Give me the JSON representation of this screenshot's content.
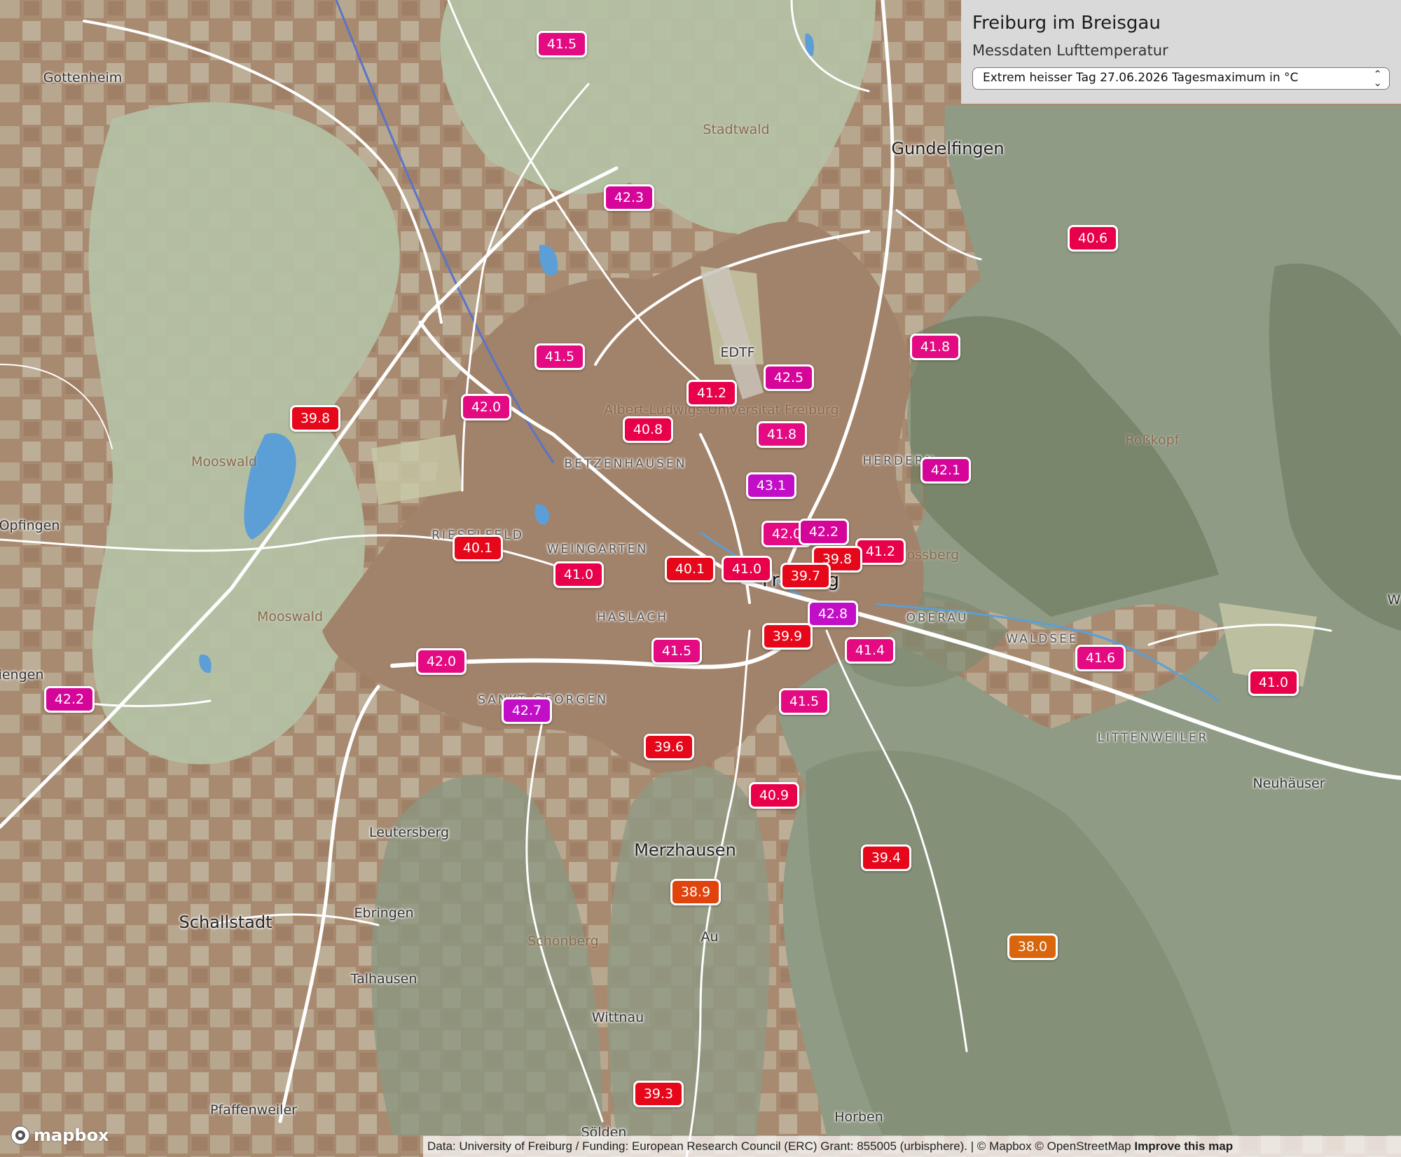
{
  "panel": {
    "title": "Freiburg im Breisgau",
    "subtitle": "Messdaten Lufttemperatur",
    "selected_option": "Extrem heisser Tag 27.06.2026 Tagesmaximum in °C"
  },
  "attribution": {
    "data_text": "Data: University of Freiburg / Funding: European Research Council (ERC) Grant: 855005 (urbisphere).",
    "separator": " | ",
    "mapbox": "© Mapbox",
    "osm": "© OpenStreetMap",
    "improve": "Improve this map"
  },
  "logo_text": "mapbox",
  "legend_colors": {
    "38.0": "#d9650c",
    "38.9": "#e0430d",
    "39.3": "#e6071a",
    "40.6": "#e8004a",
    "41.5": "#e30a82",
    "42.3": "#d6059a",
    "42.7": "#c30ec8"
  },
  "places": [
    {
      "label": "Gottenheim",
      "cls": ""
    },
    {
      "label": "Gundelfingen",
      "cls": "big"
    },
    {
      "label": "Stadtwald",
      "cls": "nature"
    },
    {
      "label": "EDTF",
      "cls": ""
    },
    {
      "label": "Mooswald",
      "cls": "nature"
    },
    {
      "label": "Mooswald",
      "cls": "nature"
    },
    {
      "label": "Opfingen",
      "cls": ""
    },
    {
      "label": "BETZENHAUSEN",
      "cls": "district"
    },
    {
      "label": "RIESELFELD",
      "cls": "district"
    },
    {
      "label": "WEINGARTEN",
      "cls": "district"
    },
    {
      "label": "HASLACH",
      "cls": "district"
    },
    {
      "label": "SANKT GEORGEN",
      "cls": "district"
    },
    {
      "label": "HERDERN",
      "cls": "district"
    },
    {
      "label": "Schlossberg",
      "cls": "nature"
    },
    {
      "label": "OBERAU",
      "cls": "district"
    },
    {
      "label": "WALDSEE",
      "cls": "district"
    },
    {
      "label": "LITTENWEILER",
      "cls": "district"
    },
    {
      "label": "Roßkopf",
      "cls": "nature"
    },
    {
      "label": "Neuhäuser",
      "cls": ""
    },
    {
      "label": "iengen",
      "cls": ""
    },
    {
      "label": "Leutersberg",
      "cls": ""
    },
    {
      "label": "Merzhausen",
      "cls": "big"
    },
    {
      "label": "Schallstadt",
      "cls": "big"
    },
    {
      "label": "Ebringen",
      "cls": ""
    },
    {
      "label": "Schönberg",
      "cls": "nature"
    },
    {
      "label": "Au",
      "cls": ""
    },
    {
      "label": "Talhausen",
      "cls": ""
    },
    {
      "label": "Wittnau",
      "cls": ""
    },
    {
      "label": "Pfaffenweiler",
      "cls": ""
    },
    {
      "label": "Horben",
      "cls": ""
    },
    {
      "label": "Sölden",
      "cls": ""
    },
    {
      "label": "W",
      "cls": ""
    },
    {
      "label": "Freiburg",
      "cls": "city"
    },
    {
      "label": "Albert-Ludwigs-Universität Freiburg",
      "cls": "nature"
    }
  ],
  "stations": [
    {
      "value": "41.5"
    },
    {
      "value": "42.3"
    },
    {
      "value": "40.6"
    },
    {
      "value": "41.8"
    },
    {
      "value": "41.5"
    },
    {
      "value": "41.2"
    },
    {
      "value": "42.5"
    },
    {
      "value": "42.0"
    },
    {
      "value": "40.8"
    },
    {
      "value": "41.8"
    },
    {
      "value": "39.8"
    },
    {
      "value": "43.1"
    },
    {
      "value": "42.1"
    },
    {
      "value": "40.1"
    },
    {
      "value": "42.0"
    },
    {
      "value": "42.2"
    },
    {
      "value": "41.2"
    },
    {
      "value": "41.0"
    },
    {
      "value": "40.1"
    },
    {
      "value": "41.0"
    },
    {
      "value": "39.8"
    },
    {
      "value": "39.7"
    },
    {
      "value": "42.8"
    },
    {
      "value": "39.9"
    },
    {
      "value": "41.4"
    },
    {
      "value": "41.5"
    },
    {
      "value": "42.0"
    },
    {
      "value": "41.6"
    },
    {
      "value": "41.0"
    },
    {
      "value": "42.2"
    },
    {
      "value": "42.7"
    },
    {
      "value": "41.5"
    },
    {
      "value": "39.6"
    },
    {
      "value": "40.9"
    },
    {
      "value": "39.4"
    },
    {
      "value": "38.9"
    },
    {
      "value": "38.0"
    },
    {
      "value": "39.3"
    }
  ]
}
